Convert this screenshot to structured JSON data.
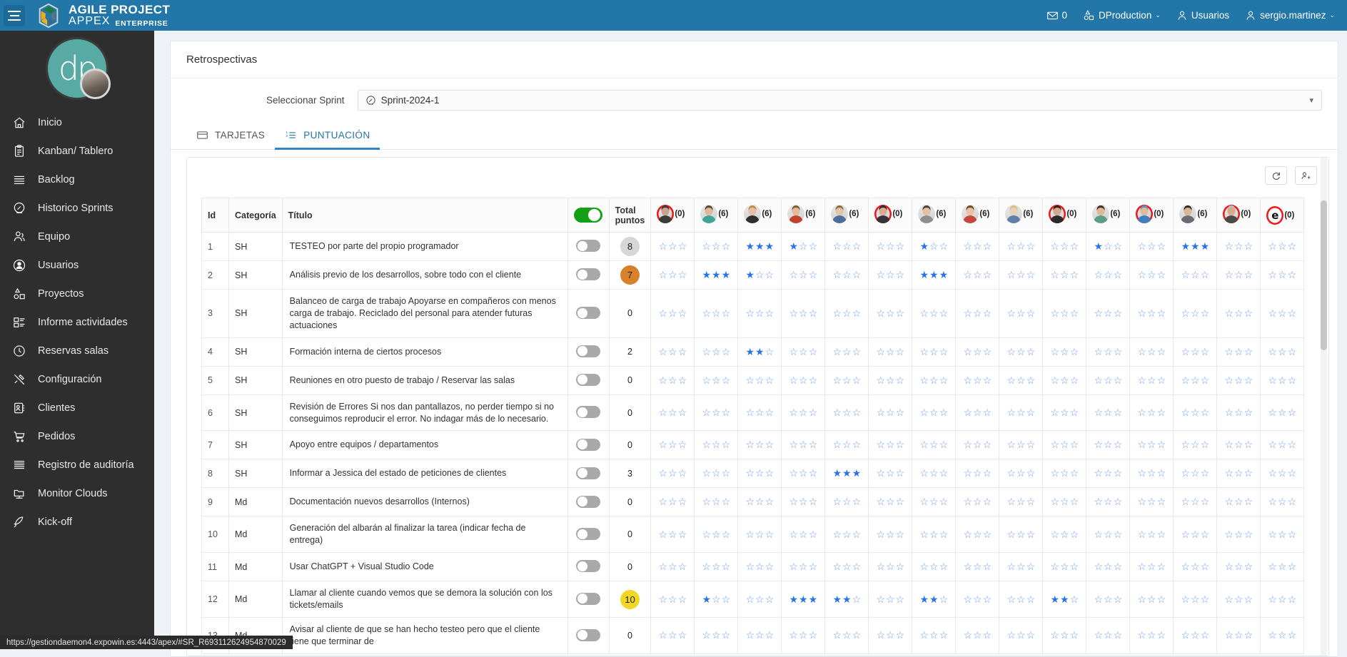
{
  "app": {
    "brand_line1": "AGILE PROJECT",
    "brand_line2": "APPEX",
    "brand_edition": "ENTERPRISE"
  },
  "topbar": {
    "mail_count": "0",
    "production_label": "DProduction",
    "usuarios_label": "Usuarios",
    "user_label": "sergio.martinez",
    "caret": "⌄"
  },
  "sidebar": {
    "avatar_initials": "dp",
    "items": [
      {
        "label": "Inicio",
        "icon": "home-icon"
      },
      {
        "label": "Kanban/ Tablero",
        "icon": "clipboard-icon"
      },
      {
        "label": "Backlog",
        "icon": "list-lines-icon"
      },
      {
        "label": "Historico Sprints",
        "icon": "speedometer-icon"
      },
      {
        "label": "Equipo",
        "icon": "people-icon"
      },
      {
        "label": "Usuarios",
        "icon": "user-circle-icon"
      },
      {
        "label": "Proyectos",
        "icon": "shapes-icon"
      },
      {
        "label": "Informe actividades",
        "icon": "report-icon"
      },
      {
        "label": "Reservas salas",
        "icon": "clock-icon"
      },
      {
        "label": "Configuración",
        "icon": "tools-icon"
      },
      {
        "label": "Clientes",
        "icon": "contact-card-icon"
      },
      {
        "label": "Pedidos",
        "icon": "cart-icon"
      },
      {
        "label": "Registro de auditoría",
        "icon": "lines-icon"
      },
      {
        "label": "Monitor Clouds",
        "icon": "monitor-folder-icon"
      },
      {
        "label": "Kick-off",
        "icon": "rocket-icon"
      }
    ]
  },
  "page": {
    "title": "Retrospectivas",
    "sprint_label": "Seleccionar Sprint",
    "sprint_value": "Sprint-2024-1",
    "tabs": [
      {
        "label": "TARJETAS",
        "icon": "card-icon",
        "active": false
      },
      {
        "label": "PUNTUACIÓN",
        "icon": "ordered-list-icon",
        "active": true
      }
    ],
    "toolbar": [
      {
        "name": "refresh-button",
        "icon": "refresh-icon"
      },
      {
        "name": "add-user-button",
        "icon": "user-plus-icon"
      }
    ]
  },
  "table": {
    "headers": {
      "id": "Id",
      "categoria": "Categoría",
      "titulo": "Título",
      "toggle": "",
      "total": "Total puntos"
    },
    "users": [
      {
        "count": "(0)",
        "ring": true,
        "hair": "#3a3a3a",
        "shirt": "#3b3b3b",
        "skin": "#caa48a",
        "letter": ""
      },
      {
        "count": "(6)",
        "ring": false,
        "hair": "#5a4635",
        "shirt": "#3fa59a",
        "skin": "#e0b79b",
        "letter": ""
      },
      {
        "count": "(6)",
        "ring": false,
        "hair": "#c08a4a",
        "shirt": "#2f2f2f",
        "skin": "#e5c0a4",
        "letter": ""
      },
      {
        "count": "(6)",
        "ring": false,
        "hair": "#7b5a3a",
        "shirt": "#c1432f",
        "skin": "#e3bb9c",
        "letter": ""
      },
      {
        "count": "(6)",
        "ring": false,
        "hair": "#8a6b45",
        "shirt": "#4a6f9c",
        "skin": "#e6c3a6",
        "letter": ""
      },
      {
        "count": "(0)",
        "ring": true,
        "hair": "#2b2b2b",
        "shirt": "#33333a",
        "skin": "#d9ae90",
        "letter": ""
      },
      {
        "count": "(6)",
        "ring": false,
        "hair": "#4a3a30",
        "shirt": "#8e8e8e",
        "skin": "#e4c1a5",
        "letter": ""
      },
      {
        "count": "(6)",
        "ring": false,
        "hair": "#6b4a2e",
        "shirt": "#c7483a",
        "skin": "#e6c3a4",
        "letter": ""
      },
      {
        "count": "(6)",
        "ring": false,
        "hair": "#d8c08a",
        "shirt": "#5e7fa8",
        "skin": "#ead0b5",
        "letter": ""
      },
      {
        "count": "(0)",
        "ring": true,
        "hair": "#2e2418",
        "shirt": "#2b2b2b",
        "skin": "#d3a98b",
        "letter": ""
      },
      {
        "count": "(6)",
        "ring": false,
        "hair": "#3c2c1e",
        "shirt": "#5e9c87",
        "skin": "#e0b89a",
        "letter": ""
      },
      {
        "count": "(0)",
        "ring": true,
        "hair": "#6a8fbb",
        "shirt": "#3f7fbf",
        "skin": "#e2b999",
        "letter": ""
      },
      {
        "count": "(6)",
        "ring": false,
        "hair": "#2f2a24",
        "shirt": "#6a6a72",
        "skin": "#dcb595",
        "letter": ""
      },
      {
        "count": "(0)",
        "ring": true,
        "hair": "#bdbdbd",
        "shirt": "#4a4a4a",
        "skin": "#d6ab8c",
        "letter": ""
      },
      {
        "count": "(0)",
        "ring": true,
        "hair": "",
        "shirt": "",
        "skin": "",
        "letter": "e"
      }
    ],
    "rows": [
      {
        "id": "1",
        "cat": "SH",
        "title": "TESTEO por parte del propio programador",
        "toggle": false,
        "total": "8",
        "pill": "grey",
        "ratings": [
          0,
          0,
          3,
          1,
          0,
          0,
          1,
          0,
          0,
          0,
          1,
          0,
          3,
          0,
          0
        ]
      },
      {
        "id": "2",
        "cat": "SH",
        "title": "Análisis previo de los desarrollos, sobre todo con el cliente",
        "toggle": false,
        "total": "7",
        "pill": "orange",
        "ratings": [
          0,
          3,
          1,
          0,
          0,
          0,
          3,
          0,
          0,
          0,
          0,
          0,
          0,
          0,
          0
        ]
      },
      {
        "id": "3",
        "cat": "SH",
        "title": "Balanceo de carga de trabajo Apoyarse en compañeros con menos carga de trabajo. Reciclado del personal para atender futuras actuaciones",
        "toggle": false,
        "total": "0",
        "pill": "none",
        "ratings": [
          0,
          0,
          0,
          0,
          0,
          0,
          0,
          0,
          0,
          0,
          0,
          0,
          0,
          0,
          0
        ]
      },
      {
        "id": "4",
        "cat": "SH",
        "title": "Formación interna de ciertos procesos",
        "toggle": false,
        "total": "2",
        "pill": "none",
        "ratings": [
          0,
          0,
          2,
          0,
          0,
          0,
          0,
          0,
          0,
          0,
          0,
          0,
          0,
          0,
          0
        ]
      },
      {
        "id": "5",
        "cat": "SH",
        "title": "Reuniones en otro puesto de trabajo / Reservar las salas",
        "toggle": false,
        "total": "0",
        "pill": "none",
        "ratings": [
          0,
          0,
          0,
          0,
          0,
          0,
          0,
          0,
          0,
          0,
          0,
          0,
          0,
          0,
          0
        ]
      },
      {
        "id": "6",
        "cat": "SH",
        "title": "Revisión de Errores Si nos dan pantallazos, no perder tiempo si no conseguimos reproducir el error. No indagar más de lo necesario.",
        "toggle": false,
        "total": "0",
        "pill": "none",
        "ratings": [
          0,
          0,
          0,
          0,
          0,
          0,
          0,
          0,
          0,
          0,
          0,
          0,
          0,
          0,
          0
        ]
      },
      {
        "id": "7",
        "cat": "SH",
        "title": "Apoyo entre equipos / departamentos",
        "toggle": false,
        "total": "0",
        "pill": "none",
        "ratings": [
          0,
          0,
          0,
          0,
          0,
          0,
          0,
          0,
          0,
          0,
          0,
          0,
          0,
          0,
          0
        ]
      },
      {
        "id": "8",
        "cat": "SH",
        "title": "Informar a Jessica del estado de peticiones de clientes",
        "toggle": false,
        "total": "3",
        "pill": "none",
        "ratings": [
          0,
          0,
          0,
          0,
          3,
          0,
          0,
          0,
          0,
          0,
          0,
          0,
          0,
          0,
          0
        ]
      },
      {
        "id": "9",
        "cat": "Md",
        "title": "Documentación nuevos desarrollos (Internos)",
        "toggle": false,
        "total": "0",
        "pill": "none",
        "ratings": [
          0,
          0,
          0,
          0,
          0,
          0,
          0,
          0,
          0,
          0,
          0,
          0,
          0,
          0,
          0
        ]
      },
      {
        "id": "10",
        "cat": "Md",
        "title": "Generación del albarán al finalizar la tarea (indicar fecha de entrega)",
        "toggle": false,
        "total": "0",
        "pill": "none",
        "ratings": [
          0,
          0,
          0,
          0,
          0,
          0,
          0,
          0,
          0,
          0,
          0,
          0,
          0,
          0,
          0
        ]
      },
      {
        "id": "11",
        "cat": "Md",
        "title": "Usar ChatGPT + Visual Studio Code",
        "toggle": false,
        "total": "0",
        "pill": "none",
        "ratings": [
          0,
          0,
          0,
          0,
          0,
          0,
          0,
          0,
          0,
          0,
          0,
          0,
          0,
          0,
          0
        ]
      },
      {
        "id": "12",
        "cat": "Md",
        "title": "Llamar al cliente cuando vemos que se demora la solución con los tickets/emails",
        "toggle": false,
        "total": "10",
        "pill": "yellow",
        "ratings": [
          0,
          1,
          0,
          3,
          2,
          0,
          2,
          0,
          0,
          2,
          0,
          0,
          0,
          0,
          0
        ]
      },
      {
        "id": "13",
        "cat": "Md",
        "title": "Avisar al cliente de que se han hecho testeo pero que el cliente tiene que terminar de",
        "toggle": false,
        "total": "0",
        "pill": "none",
        "ratings": [
          0,
          0,
          0,
          0,
          0,
          0,
          0,
          0,
          0,
          0,
          0,
          0,
          0,
          0,
          0
        ]
      }
    ]
  },
  "statusbar": {
    "url": "https://gestiondaemon4.expowin.es:4443/apex/#SR_R693112624954870029"
  },
  "colors": {
    "topbar": "#2277a8",
    "sidebar": "#2e2e2e",
    "accent": "#2e86c4",
    "toggle_on": "#14a014",
    "star_on": "#2a72e8",
    "star_off": "#6f9ceb"
  }
}
